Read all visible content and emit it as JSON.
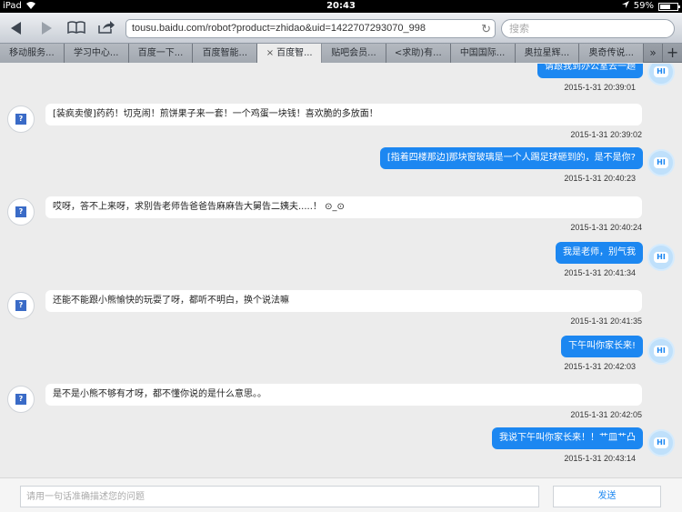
{
  "status_bar": {
    "device": "iPad",
    "time": "20:43",
    "battery": "59%",
    "battery_level": 0.59
  },
  "toolbar": {
    "url": "tousu.baidu.com/robot?product=zhidao&uid=1422707293070_998",
    "search_placeholder": "搜索"
  },
  "tabs": [
    {
      "label": "移动服务..."
    },
    {
      "label": "学习中心..."
    },
    {
      "label": "百度一下..."
    },
    {
      "label": "百度智能..."
    },
    {
      "label": "百度智...",
      "close": "×"
    },
    {
      "label": "贴吧会员..."
    },
    {
      "label": "<求助)有..."
    },
    {
      "label": "中国国际..."
    },
    {
      "label": "奥拉星辉..."
    },
    {
      "label": "奥奇传说..."
    }
  ],
  "tab_more": "»",
  "tab_add": "+",
  "avatar_bot_glyph": "?",
  "avatar_user_glyph": "HI",
  "messages": [
    {
      "from": "user",
      "text": "请跟我到办公室去一趟",
      "time": "2015-1-31 20:39:01"
    },
    {
      "from": "bot",
      "text": "[装疯卖傻]药药！切克闹！煎饼果子来一套！一个鸡蛋一块钱！喜欢脆的多放面！",
      "time": "2015-1-31 20:39:02"
    },
    {
      "from": "user",
      "text": "[指着四楼那边]那块窗玻璃是一个人踢足球砸到的，是不是你?",
      "time": "2015-1-31 20:40:23"
    },
    {
      "from": "bot",
      "text": "哎呀，答不上来呀，求别告老师告爸爸告麻麻告大舅告二姨夫.....！ ⊙_⊙",
      "time": "2015-1-31 20:40:24"
    },
    {
      "from": "user",
      "text": "我是老师，别气我",
      "time": "2015-1-31 20:41:34"
    },
    {
      "from": "bot",
      "text": "还能不能跟小熊愉快的玩耍了呀，都听不明白，换个说法嘛",
      "time": "2015-1-31 20:41:35"
    },
    {
      "from": "user",
      "text": "下午叫你家长来!",
      "time": "2015-1-31 20:42:03"
    },
    {
      "from": "bot",
      "text": "是不是小熊不够有才呀，都不懂你说的是什么意思。。",
      "time": "2015-1-31 20:42:05"
    },
    {
      "from": "user",
      "text": "我说下午叫你家长来！！艹皿艹凸",
      "time": "2015-1-31 20:43:14"
    }
  ],
  "input": {
    "placeholder": "请用一句话准确描述您的问题",
    "send_label": "发送"
  }
}
